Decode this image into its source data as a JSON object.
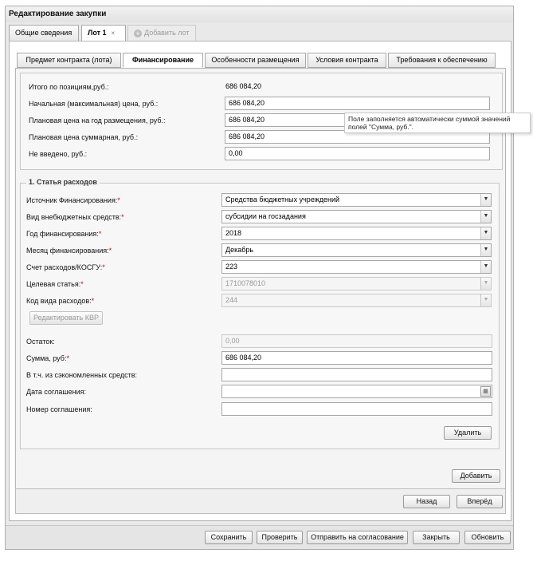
{
  "window": {
    "title": "Редактирование закупки"
  },
  "top_tabs": [
    {
      "label": "Общие сведения"
    },
    {
      "label": "Лот 1",
      "close": "×"
    },
    {
      "label": "Добавить лот"
    }
  ],
  "inner_tabs": [
    {
      "label": "Предмет контракта (лота)"
    },
    {
      "label": "Финансирование"
    },
    {
      "label": "Особенности размещения"
    },
    {
      "label": "Условия контракта"
    },
    {
      "label": "Требования к обеспечению"
    }
  ],
  "totals": {
    "items_total_label": "Итого по позициям,руб.:",
    "items_total_value": "686 084,20",
    "initial_price_label": "Начальная (максимальная) цена, руб.:",
    "initial_price_value": "686 084,20",
    "planned_year_label": "Плановая цена на год размещения, руб.:",
    "planned_year_value": "686 084,20",
    "planned_total_label": "Плановая цена суммарная, руб.:",
    "planned_total_value": "686 084,20",
    "not_entered_label": "Не введено, руб.:",
    "not_entered_value": "0,00"
  },
  "tooltip": {
    "text": "Поле заполняется автоматически суммой значений полей \"Сумма, руб.\"."
  },
  "expense": {
    "legend": "1. Статья расходов",
    "source_label": "Источник Финансирования:",
    "source_value": "Средства бюджетных учреждений",
    "offbudget_label": "Вид внебюджетных средств:",
    "offbudget_value": "субсидии на госзадания",
    "year_label": "Год финансирования:",
    "year_value": "2018",
    "month_label": "Месяц финансирования:",
    "month_value": "Декабрь",
    "account_label": "Счет расходов/КОСГУ:",
    "account_value": "223",
    "target_label": "Целевая статья:",
    "target_value": "1710078010",
    "kvr_label": "Код вида расходов:",
    "kvr_value": "244",
    "edit_kvr_button": "Редактировать КВР",
    "remainder_label": "Остаток:",
    "remainder_value": "0,00",
    "sum_label": "Сумма, руб:",
    "sum_value": "686 084,20",
    "savings_label": "В т.ч. из сэкономленных средств:",
    "savings_value": "",
    "agreement_date_label": "Дата соглашения:",
    "agreement_date_value": "",
    "agreement_number_label": "Номер соглашения:",
    "agreement_number_value": "",
    "delete_button": "Удалить",
    "required_mark": "*"
  },
  "add_button": "Добавить",
  "nav": {
    "back": "Назад",
    "forward": "Вперёд"
  },
  "bottom": {
    "save": "Сохранить",
    "check": "Проверить",
    "send": "Отправить на согласование",
    "close": "Закрыть",
    "refresh": "Обновить"
  },
  "icons": {
    "dropdown": "▼",
    "add": "+",
    "calendar": "▦"
  }
}
